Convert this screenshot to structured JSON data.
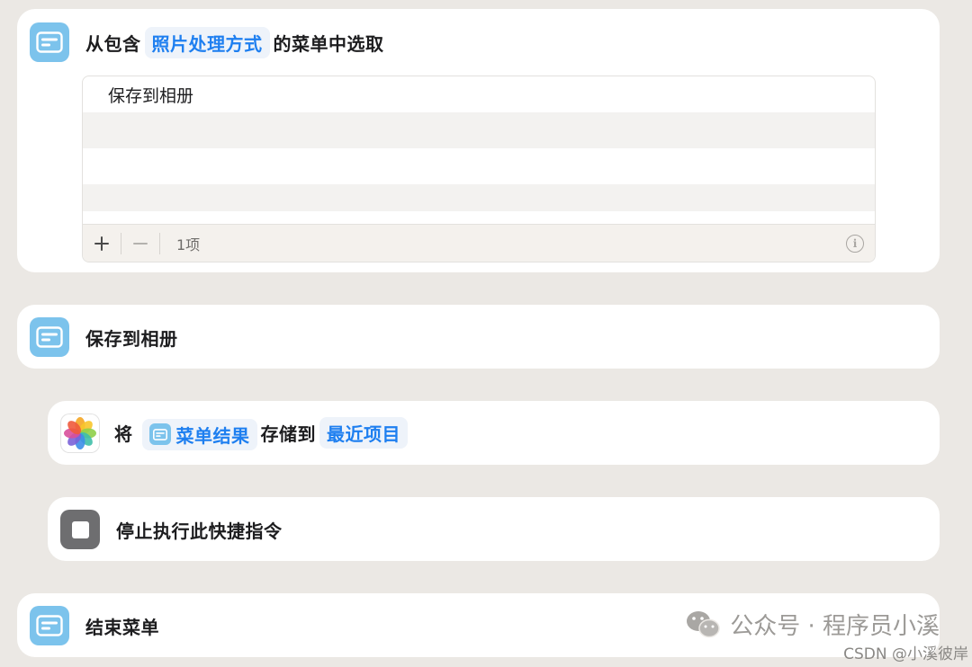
{
  "menu_action": {
    "prefix": "从包含",
    "variable": "照片处理方式",
    "suffix": "的菜单中选取",
    "items": [
      "保存到相册",
      "",
      "",
      ""
    ],
    "count_label": "1项",
    "add_symbol": "+",
    "remove_symbol": "−",
    "info_symbol": "i"
  },
  "menu_case": {
    "title": "保存到相册"
  },
  "save_action": {
    "verb": "将",
    "variable": "菜单结果",
    "middle": "存储到",
    "destination": "最近项目"
  },
  "stop_action": {
    "title": "停止执行此快捷指令"
  },
  "end_menu": {
    "title": "结束菜单"
  },
  "watermark": {
    "text": "公众号 · 程序员小溪",
    "csdn": "CSDN @小溪彼岸"
  },
  "colors": {
    "background": "#ebe8e4",
    "card": "#ffffff",
    "menu_icon": "#7cc3ec",
    "token_text": "#1e7ff0",
    "stop_icon": "#6e6e70"
  },
  "icons": {
    "menu": "menu-list-icon",
    "photos": "photos-app-icon",
    "stop": "stop-icon",
    "add": "plus-icon",
    "remove": "minus-icon",
    "info": "info-icon"
  }
}
